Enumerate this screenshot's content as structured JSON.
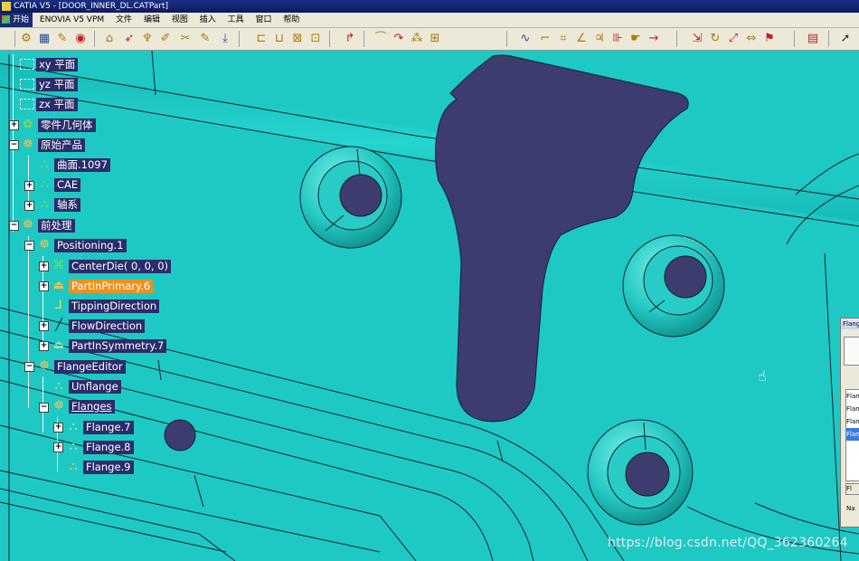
{
  "window": {
    "title": "CATIA V5 - [DOOR_INNER_DL.CATPart]"
  },
  "menu": {
    "start": "开始",
    "items": [
      "ENOVIA V5 VPM",
      "文件",
      "编辑",
      "视图",
      "插入",
      "工具",
      "窗口",
      "帮助"
    ]
  },
  "tree": {
    "nodes": [
      {
        "id": "xy",
        "label": "xy 平面",
        "icon": "plane-icon"
      },
      {
        "id": "yz",
        "label": "yz 平面",
        "icon": "plane-icon"
      },
      {
        "id": "zx",
        "label": "zx 平面",
        "icon": "plane-icon"
      },
      {
        "id": "body",
        "label": "零件几何体",
        "icon": "gear-icon"
      },
      {
        "id": "orig",
        "label": "原始产品",
        "icon": "product-icon"
      },
      {
        "id": "surf",
        "label": "曲面.1097",
        "icon": "surface-icon"
      },
      {
        "id": "cae",
        "label": "CAE",
        "icon": "surface-icon"
      },
      {
        "id": "axis",
        "label": "轴系",
        "icon": "surface-icon"
      },
      {
        "id": "pre",
        "label": "前处理",
        "icon": "product-icon"
      },
      {
        "id": "pos",
        "label": "Positioning.1",
        "icon": "product-icon"
      },
      {
        "id": "cd",
        "label": "CenterDie(    0,    0,    0)",
        "icon": "die-icon"
      },
      {
        "id": "pip",
        "label": "PartInPrimary.6",
        "icon": "part-icon"
      },
      {
        "id": "tip",
        "label": "TippingDirection",
        "icon": "axis-icon"
      },
      {
        "id": "flow",
        "label": "FlowDirection",
        "icon": "arrow-icon"
      },
      {
        "id": "pis",
        "label": "PartInSymmetry.7",
        "icon": "part-icon"
      },
      {
        "id": "fe",
        "label": "FlangeEditor",
        "icon": "product-icon"
      },
      {
        "id": "unf",
        "label": "Unflange",
        "icon": "flange-icon"
      },
      {
        "id": "fls",
        "label": "Flanges",
        "icon": "product-icon"
      },
      {
        "id": "f7",
        "label": "Flange.7",
        "icon": "flange-icon"
      },
      {
        "id": "f8",
        "label": "Flange.8",
        "icon": "flange-icon"
      },
      {
        "id": "f9",
        "label": "Flange.9",
        "icon": "flange-icon"
      }
    ]
  },
  "dialog": {
    "title": "Flange",
    "list": [
      "Flan",
      "Flan",
      "Flan",
      "Flan"
    ],
    "button": "Fl",
    "name_label": "Na"
  },
  "watermark": "https://blog.csdn.net/QQ_362360264",
  "colors": {
    "viewport_bg": "#1ec9c4",
    "surface_dark": "#3d3c6e",
    "tree_label_bg": "#2b2c6b",
    "selection": "#f0901c"
  }
}
